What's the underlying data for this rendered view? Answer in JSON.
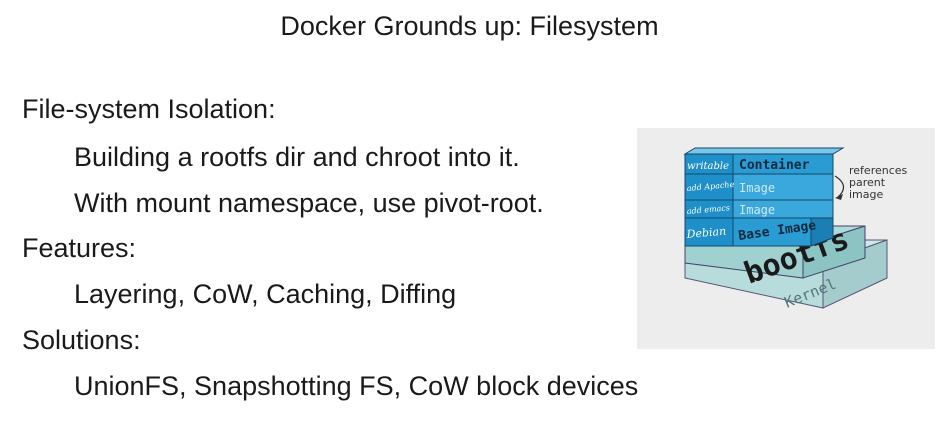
{
  "slide": {
    "title": "Docker Grounds up: Filesystem",
    "lines": [
      {
        "text": "File-system Isolation:",
        "indent": 0
      },
      {
        "text": "Building a rootfs dir and chroot into it.",
        "indent": 1
      },
      {
        "text": "With mount namespace, use pivot-root.",
        "indent": 1
      },
      {
        "text": "Features:",
        "indent": 0
      },
      {
        "text": "Layering, CoW, Caching, Diffing",
        "indent": 1
      },
      {
        "text": "Solutions:",
        "indent": 0
      },
      {
        "text": "UnionFS, Snapshotting FS, CoW block devices",
        "indent": 1
      }
    ]
  },
  "diagram": {
    "layers": {
      "container_side": "writable",
      "container_label": "Container",
      "image1_side": "add Apache",
      "image1_label": "Image",
      "image2_side": "add emacs",
      "image2_label": "Image",
      "base_side": "Debian",
      "base_label": "Base Image",
      "bootfs_label": "bootfs",
      "kernel_label": "Kernel"
    },
    "annotation": [
      "references",
      "parent",
      "image"
    ],
    "colors": {
      "layer_blue": "#1e8fc9",
      "layer_blue_light": "#3aa8dc",
      "layer_blue_top": "#7cc6ea",
      "base_teal": "#9fd1d1",
      "kernel_teal": "#b8dcdc",
      "bootfs_text": "#1a1a1a"
    }
  }
}
